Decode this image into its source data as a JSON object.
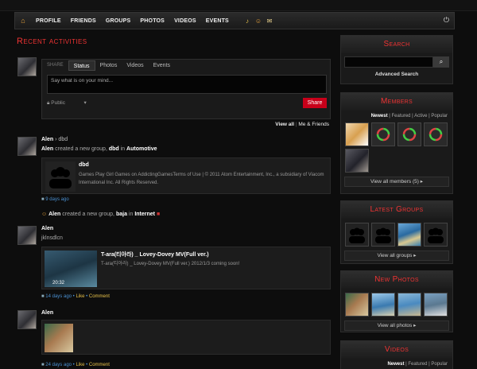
{
  "nav": {
    "items": [
      "Profile",
      "Friends",
      "Groups",
      "Photos",
      "Videos",
      "Events"
    ]
  },
  "activities": {
    "title": "Recent activities",
    "composer": {
      "tab_label": "SHARE",
      "tabs": [
        "Status",
        "Photos",
        "Videos",
        "Events"
      ],
      "placeholder": "Say what is on your mind...",
      "privacy": "Public",
      "share_label": "Share"
    },
    "view_all": "View all",
    "view_me_friends": "Me & Friends"
  },
  "feed": [
    {
      "name": "Alen",
      "target": "dbd",
      "line_pre": "Alen",
      "line_mid": "created a new group,",
      "line_group": "dbd",
      "line_in": "in",
      "line_cat": "Automotive",
      "card_title": "dbd",
      "card_text": "Games Play Girl Games on AddictingGamesTerms of Use | © 2011 Atom Entertainment, Inc., a subsidiary of Viacom International Inc. All Rights Reserved.",
      "time": "9 days ago"
    },
    {
      "line_pre": "Alen",
      "line_mid": "created a new group,",
      "line_group": "baja",
      "line_in": "in",
      "line_cat": "Internet"
    },
    {
      "name": "Alen",
      "status": "jklnsdlcn",
      "card_title": "T-ara(티아라) _ Lovey-Dovey MV(Full ver.)",
      "card_text": "T-ara(티아라) _ Lovey-Dovey MV(Full ver.) 2012/1/3 coming soon!",
      "duration": "20:32",
      "time": "14 days ago",
      "sep1": " • ",
      "like": "Like",
      "sep2": " • ",
      "comment": "Comment"
    },
    {
      "name": "Alen",
      "time": "24 days ago",
      "sep1": " • ",
      "like": "Like",
      "sep2": " • ",
      "comment": "Comment"
    }
  ],
  "sidebar": {
    "search": {
      "title": "Search",
      "advanced": "Advanced Search"
    },
    "members": {
      "title": "Members",
      "filters": [
        "Newest",
        "Featured",
        "Active",
        "Popular"
      ],
      "view_all": "View all members (5)"
    },
    "groups": {
      "title": "Latest Groups",
      "view_all": "View all groups"
    },
    "photos": {
      "title": "New Photos",
      "view_all": "View all photos"
    },
    "videos": {
      "title": "Videos",
      "filters": [
        "Newest",
        "Featured",
        "Popular"
      ]
    }
  },
  "colors": {
    "accent": "#e33333",
    "share": "#c8001a",
    "link": "#4a8fd0"
  }
}
